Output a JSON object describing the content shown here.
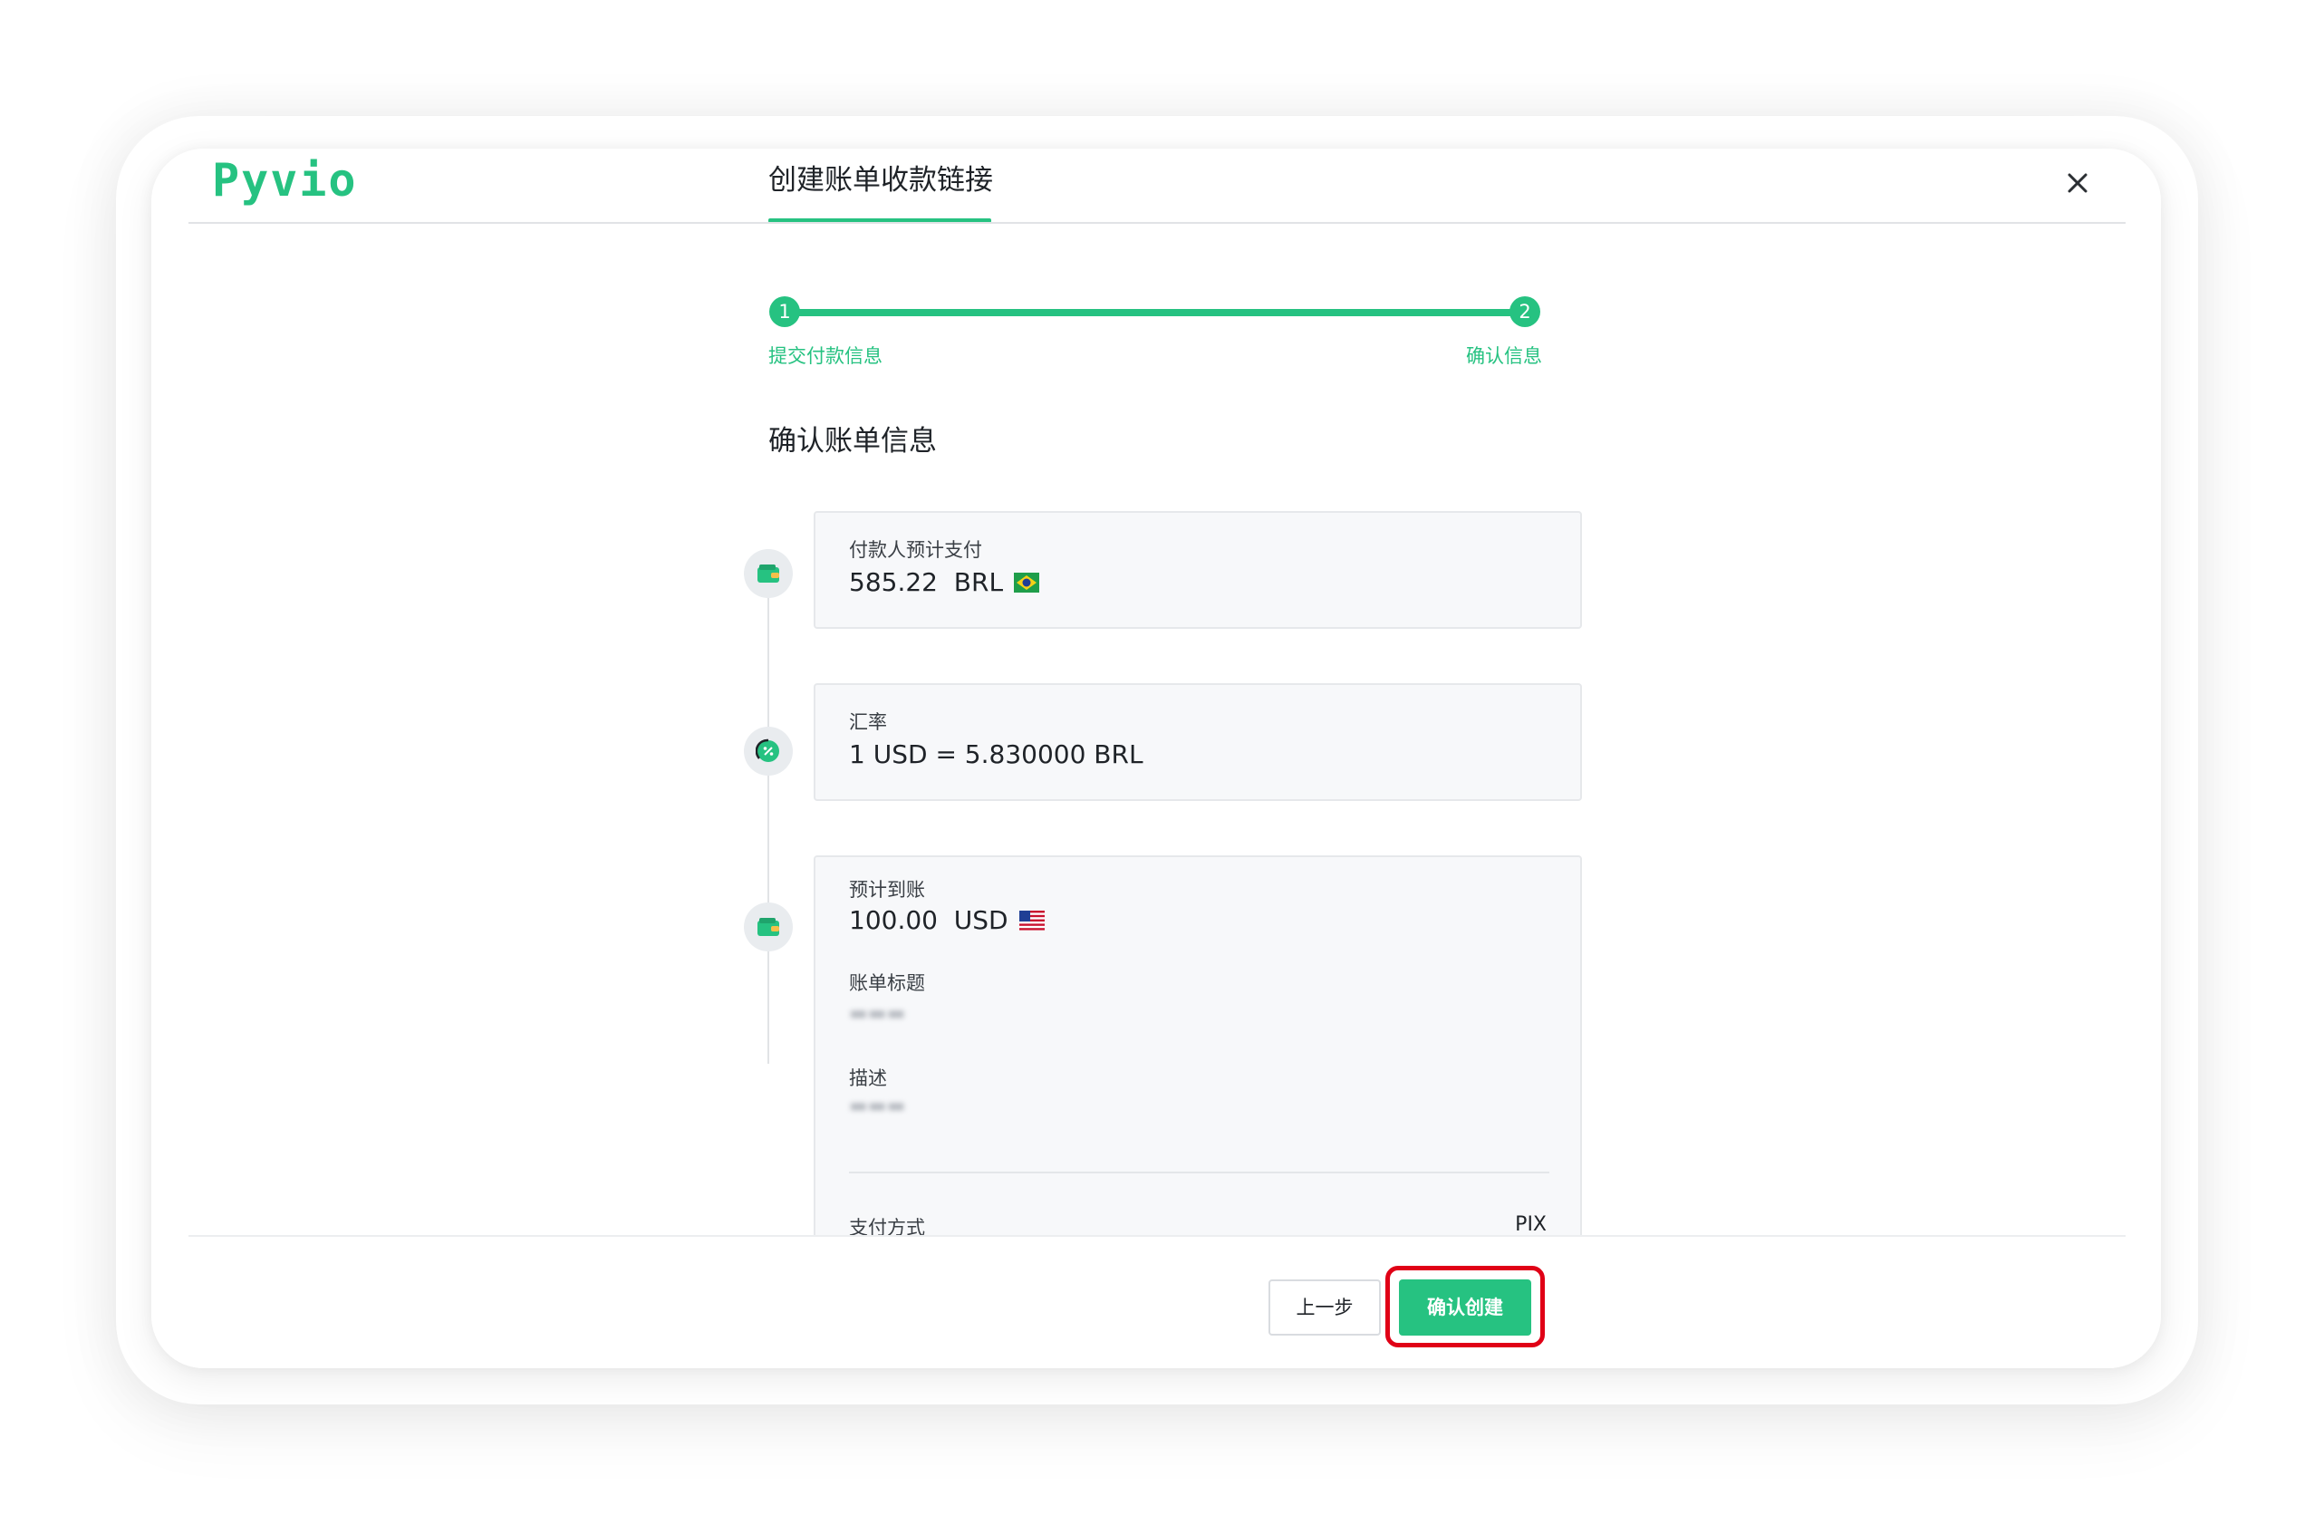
{
  "header": {
    "logo": "Pyvio",
    "title": "创建账单收款链接"
  },
  "stepper": {
    "steps": [
      {
        "number": "1",
        "label": "提交付款信息"
      },
      {
        "number": "2",
        "label": "确认信息"
      }
    ]
  },
  "section_title": "确认账单信息",
  "cards": {
    "payer": {
      "label": "付款人预计支付",
      "value": "585.22  BRL",
      "flag": "brazil-flag-icon"
    },
    "rate": {
      "label": "汇率",
      "value": "1 USD = 5.830000 BRL"
    },
    "receive": {
      "label": "预计到账",
      "value": "100.00  USD",
      "flag": "us-flag-icon",
      "bill_title_label": "账单标题",
      "description_label": "描述",
      "payment_method_label": "支付方式",
      "payment_method_value": "PIX"
    }
  },
  "footer": {
    "prev_label": "上一步",
    "confirm_label": "确认创建"
  },
  "colors": {
    "accent": "#26c281",
    "highlight": "#e00016"
  }
}
